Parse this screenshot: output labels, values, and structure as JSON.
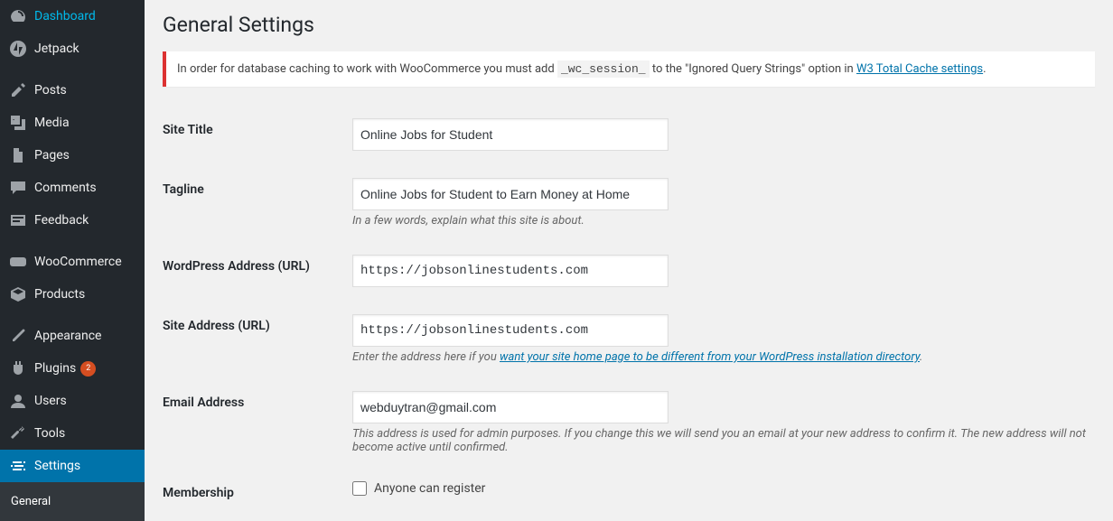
{
  "sidebar": {
    "items": [
      {
        "label": "Dashboard",
        "icon": "dashboard-icon",
        "active": false,
        "badge": null
      },
      {
        "label": "Jetpack",
        "icon": "jetpack-icon",
        "active": false,
        "badge": null
      },
      {
        "label": "Posts",
        "icon": "posts-icon",
        "active": false,
        "badge": null
      },
      {
        "label": "Media",
        "icon": "media-icon",
        "active": false,
        "badge": null
      },
      {
        "label": "Pages",
        "icon": "pages-icon",
        "active": false,
        "badge": null
      },
      {
        "label": "Comments",
        "icon": "comments-icon",
        "active": false,
        "badge": null
      },
      {
        "label": "Feedback",
        "icon": "feedback-icon",
        "active": false,
        "badge": null
      },
      {
        "label": "WooCommerce",
        "icon": "woocommerce-icon",
        "active": false,
        "badge": null
      },
      {
        "label": "Products",
        "icon": "products-icon",
        "active": false,
        "badge": null
      },
      {
        "label": "Appearance",
        "icon": "appearance-icon",
        "active": false,
        "badge": null
      },
      {
        "label": "Plugins",
        "icon": "plugins-icon",
        "active": false,
        "badge": "2"
      },
      {
        "label": "Users",
        "icon": "users-icon",
        "active": false,
        "badge": null
      },
      {
        "label": "Tools",
        "icon": "tools-icon",
        "active": false,
        "badge": null
      },
      {
        "label": "Settings",
        "icon": "settings-icon",
        "active": true,
        "badge": null
      }
    ],
    "submenu": {
      "items": [
        {
          "label": "General"
        }
      ]
    }
  },
  "page": {
    "title": "General Settings"
  },
  "notice": {
    "pre": "In order for database caching to work with WooCommerce you must add ",
    "code": "_wc_session_",
    "mid": " to the \"Ignored Query Strings\" option in ",
    "link": "W3 Total Cache settings",
    "post": "."
  },
  "fields": {
    "site_title": {
      "label": "Site Title",
      "value": "Online Jobs for Student"
    },
    "tagline": {
      "label": "Tagline",
      "value": "Online Jobs for Student to Earn Money at Home",
      "desc": "In a few words, explain what this site is about."
    },
    "wp_address": {
      "label": "WordPress Address (URL)",
      "value": "https://jobsonlinestudents.com"
    },
    "site_address": {
      "label": "Site Address (URL)",
      "value": "https://jobsonlinestudents.com",
      "desc_pre": "Enter the address here if you ",
      "desc_link": "want your site home page to be different from your WordPress installation directory",
      "desc_post": "."
    },
    "email": {
      "label": "Email Address",
      "value": "webduytran@gmail.com",
      "desc": "This address is used for admin purposes. If you change this we will send you an email at your new address to confirm it. The new address will not become active until confirmed."
    },
    "membership": {
      "label": "Membership",
      "checkbox_label": "Anyone can register"
    }
  }
}
